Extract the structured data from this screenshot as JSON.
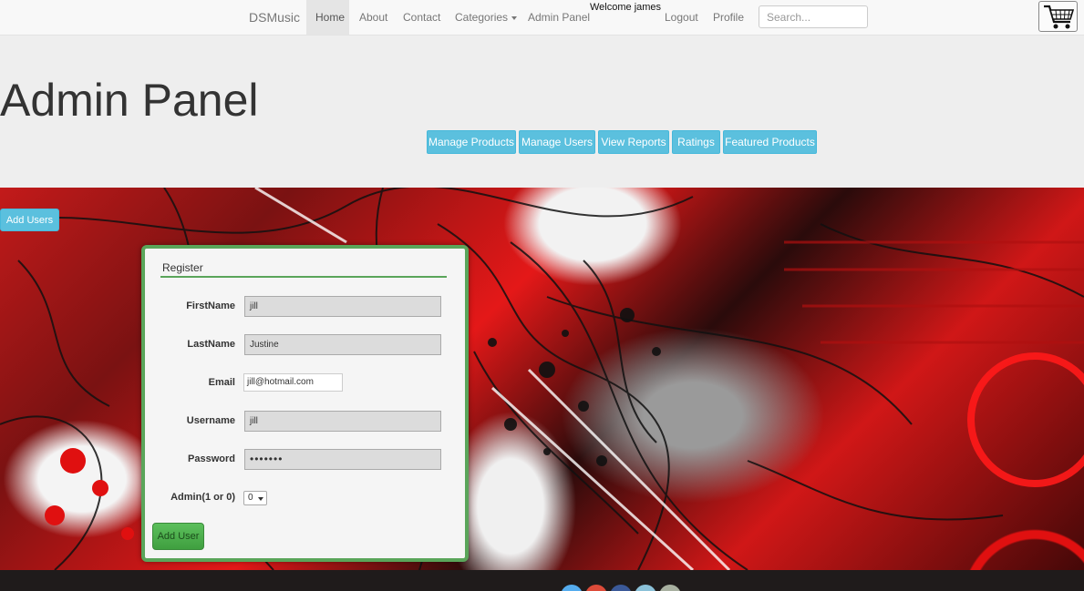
{
  "nav": {
    "brand": "DSMusic",
    "home": "Home",
    "about": "About",
    "contact": "Contact",
    "categories": "Categories",
    "admin_panel": "Admin Panel",
    "welcome": "Welcome james",
    "logout": "Logout",
    "profile": "Profile",
    "search_placeholder": "Search..."
  },
  "header": {
    "title": "Admin Panel",
    "tabs": [
      "Manage Products",
      "Manage Users",
      "View Reports",
      "Ratings",
      "Featured Products"
    ]
  },
  "add_users_label": "Add Users",
  "form": {
    "legend": "Register",
    "firstname_label": "FirstName",
    "firstname_value": "jill",
    "lastname_label": "LastName",
    "lastname_value": "Justine",
    "email_label": "Email",
    "email_value": "jill@hotmail.com",
    "username_label": "Username",
    "username_value": "jill",
    "password_label": "Password",
    "password_value": "•••••••",
    "admin_label": "Admin(1 or 0)",
    "admin_value": "0",
    "submit_label": "Add User"
  },
  "colors": {
    "accent": "#5bc0de",
    "form_border": "#5aa55a",
    "submit": "#4cae4c"
  },
  "icons": {
    "cart": "shopping-cart-icon",
    "caret": "chevron-down-icon"
  }
}
